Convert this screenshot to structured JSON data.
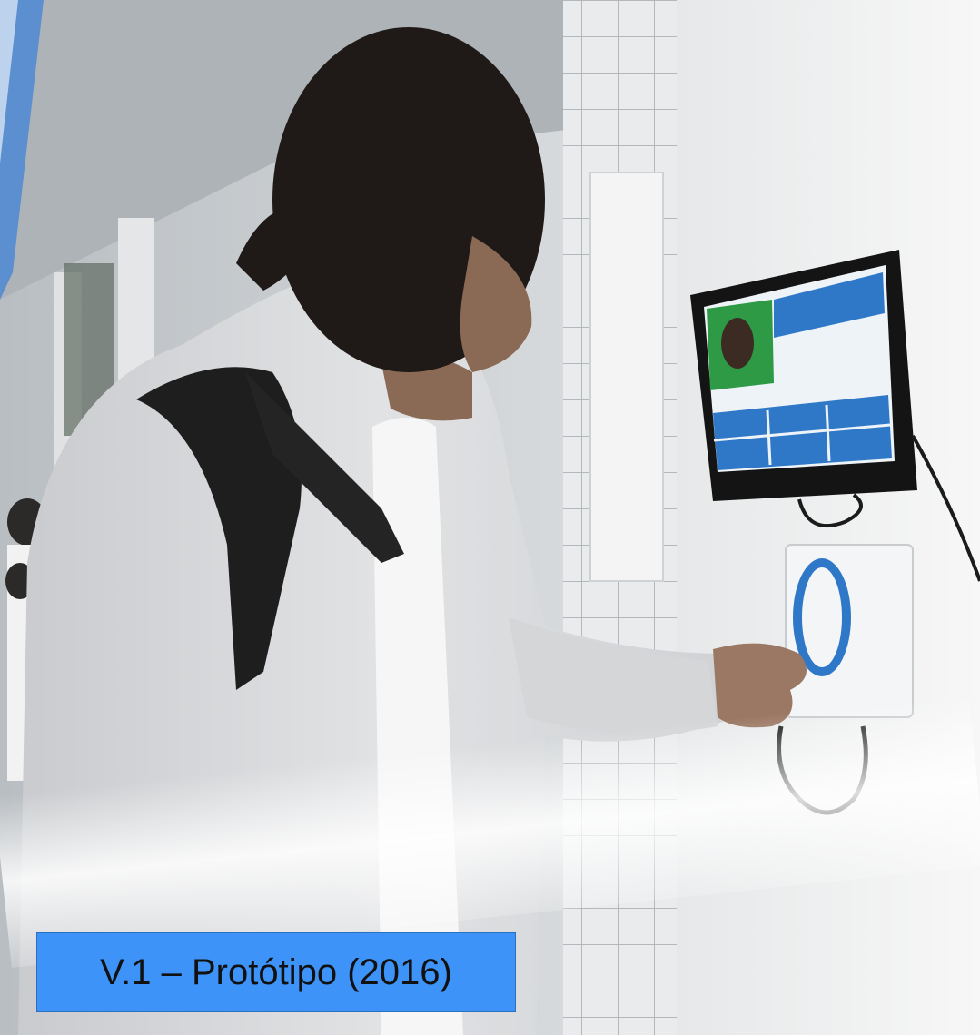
{
  "caption": {
    "text": "V.1 – Protótipo (2016)"
  },
  "colors": {
    "caption_bg": "#3d93f8",
    "accent_stripe": "#5b8fd0",
    "wall": "#f2f3f3",
    "hoodie": "#d9dadc",
    "screen_green": "#2e9a46",
    "screen_blue": "#2f78c8"
  },
  "scene": {
    "subject": "student-at-kiosk",
    "objects": [
      "wall-monitor",
      "card-reader",
      "backpack",
      "tiled-column",
      "corridor"
    ]
  }
}
